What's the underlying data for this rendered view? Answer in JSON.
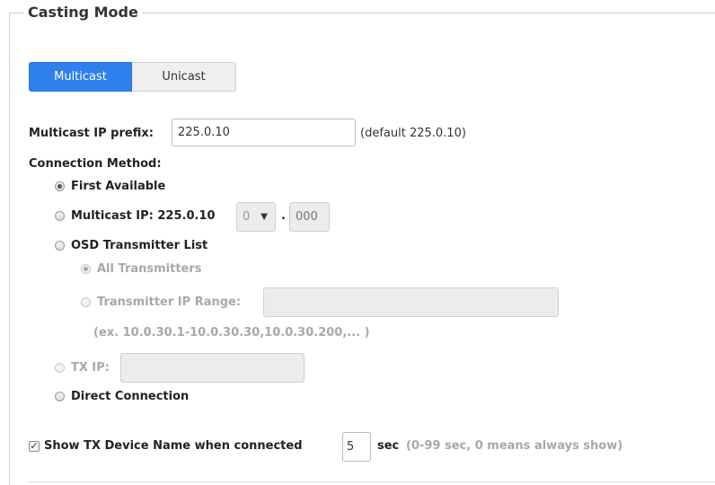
{
  "section": {
    "title": "Casting Mode"
  },
  "mode_toggle": {
    "multicast": "Multicast",
    "unicast": "Unicast",
    "selected": "Multicast"
  },
  "multicast_prefix": {
    "label": "Multicast IP prefix:",
    "value": "225.0.10",
    "hint": "(default 225.0.10)"
  },
  "connection": {
    "label": "Connection Method:",
    "first_available": "First Available",
    "multicast_ip": {
      "label": "Multicast IP: 225.0.10",
      "octet3": "0",
      "dot": ".",
      "octet4_placeholder": "000"
    },
    "osd_list": {
      "label": "OSD Transmitter List",
      "all": "All Transmitters",
      "range_label": "Transmitter IP Range:",
      "range_value": "",
      "example": "(ex. 10.0.30.1-10.0.30.30,10.0.30.200,... )"
    },
    "tx_ip": {
      "label": "TX IP:",
      "value": ""
    },
    "direct": "Direct Connection",
    "selected": "First Available"
  },
  "show_name": {
    "label": "Show TX Device Name when connected",
    "checked": true,
    "value": "5",
    "unit": "sec",
    "hint": "(0-99 sec, 0 means always show)"
  },
  "colors": {
    "accent": "#2f80ed",
    "muted": "#a8a8a8"
  }
}
